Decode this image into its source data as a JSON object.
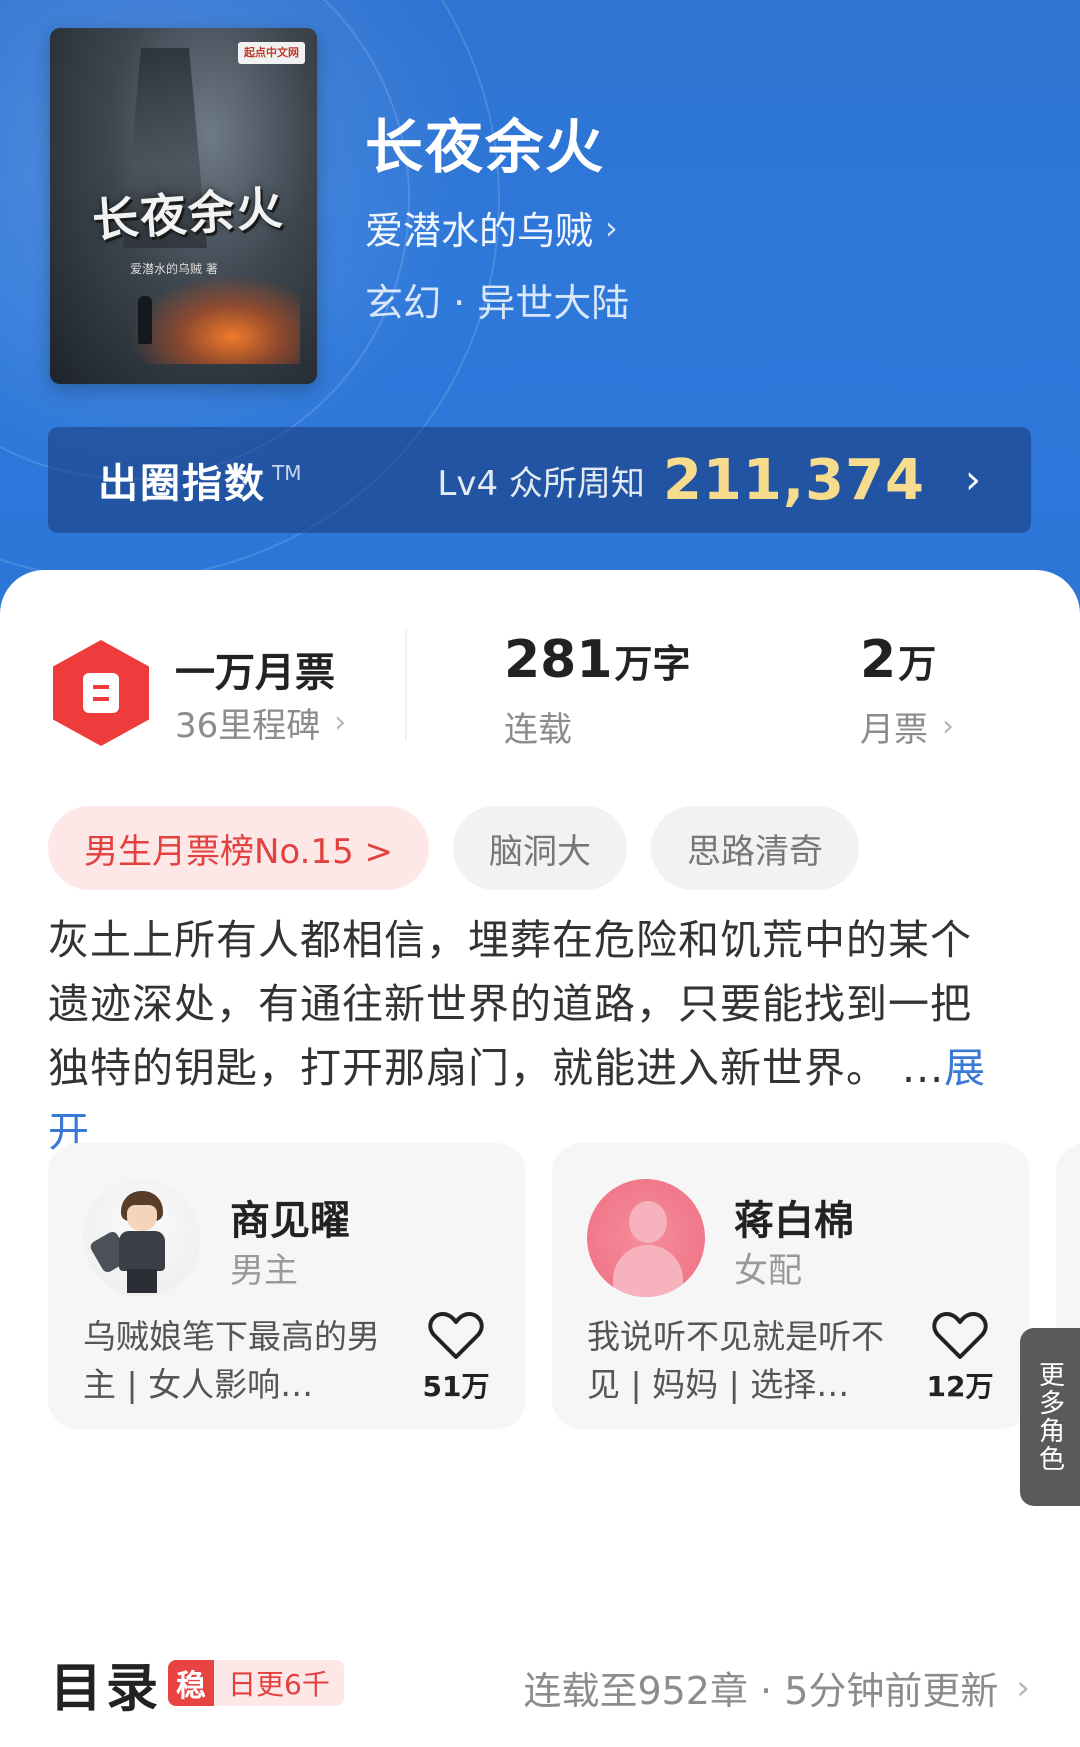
{
  "book": {
    "title": "长夜余火",
    "author": "爱潜水的乌贼",
    "genre": "玄幻 · 异世大陆",
    "cover": {
      "publisher_badge": "起点中文网",
      "title_art": "长夜余火",
      "author_art": "爱潜水的乌贼 著"
    }
  },
  "index_bar": {
    "label": "出圈指数",
    "tm": "TM",
    "level": "Lv4 众所周知",
    "score": "211,374"
  },
  "stats": {
    "ticket_title": "一万月票",
    "ticket_sub": "36里程碑",
    "words_num": "281",
    "words_unit": "万字",
    "words_label": "连载",
    "votes_num": "2",
    "votes_unit": "万",
    "votes_label": "月票"
  },
  "tags": [
    "男生月票榜No.15 >",
    "脑洞大",
    "思路清奇"
  ],
  "synopsis": {
    "text": "灰土上所有人都相信，埋葬在危险和饥荒中的某个遗迹深处，有通往新世界的道路，只要能找到一把独特的钥匙，打开那扇门，就能进入新世界。 ...",
    "expand": "展开"
  },
  "characters": [
    {
      "name": "商见曜",
      "role": "男主",
      "desc": "乌贼娘笔下最高的男主 | 女人影响…",
      "likes": "51万"
    },
    {
      "name": "蒋白棉",
      "role": "女配",
      "desc": "我说听不见就是听不见 | 妈妈 | 选择…",
      "likes": "12万"
    }
  ],
  "more_roles": "更多角色",
  "toc": {
    "title": "目录",
    "badge_char": "稳",
    "badge_text": "日更6千",
    "status": "连载至952章 · 5分钟前更新"
  },
  "colors": {
    "header_blue": "#2e78da",
    "gold_score": "#f6dc8c",
    "accent_red": "#e84242",
    "link_blue": "#3a78d6"
  }
}
